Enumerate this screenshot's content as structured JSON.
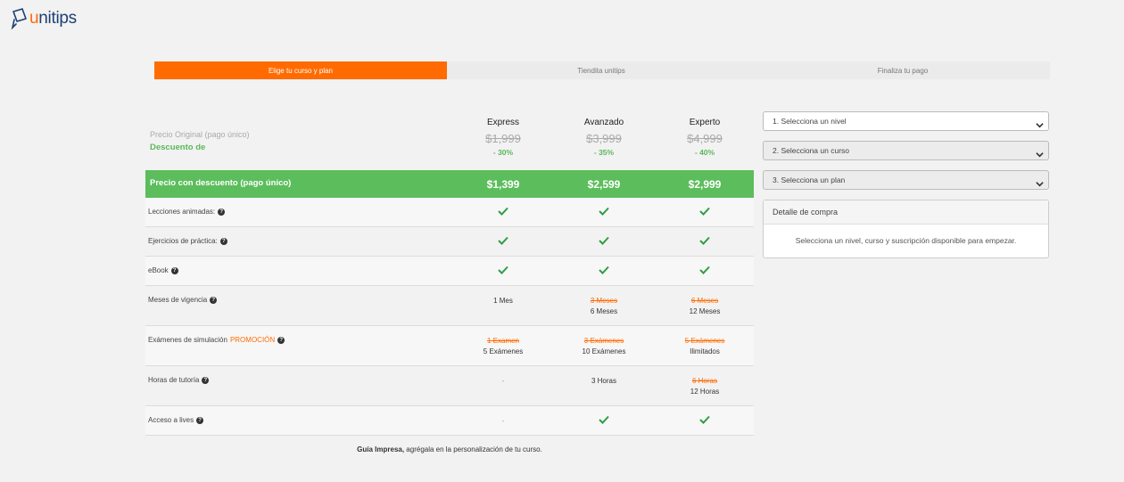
{
  "brand": {
    "logo_text_accent": "u",
    "logo_text_rest": "nitips"
  },
  "steps": [
    {
      "label": "Elige tu curso y plan",
      "active": true
    },
    {
      "label": "Tiendita unitips",
      "active": false
    },
    {
      "label": "Finaliza tu pago",
      "active": false
    }
  ],
  "plans_header": {
    "original_label": "Precio Original (pago único)",
    "discount_label": "Descuento de"
  },
  "plans": [
    {
      "name": "Express",
      "original": "$1,999",
      "discount": "- 30%",
      "price": "$1,399"
    },
    {
      "name": "Avanzado",
      "original": "$3,999",
      "discount": "- 35%",
      "price": "$2,599"
    },
    {
      "name": "Experto",
      "original": "$4,999",
      "discount": "- 40%",
      "price": "$2,999"
    }
  ],
  "price_row_label": "Precio con descuento (pago único)",
  "features": [
    {
      "label": "Lecciones animadas:"
    },
    {
      "label": "Ejercicios de práctica:"
    },
    {
      "label": "eBook"
    },
    {
      "label": "Meses de vigencia",
      "cells": [
        {
          "strike": "",
          "value": "1 Mes"
        },
        {
          "strike": "3 Meses",
          "value": "6 Meses"
        },
        {
          "strike": "6 Meses",
          "value": "12 Meses"
        }
      ]
    },
    {
      "label": "Exámenes de simulación",
      "promo": "PROMOCIÓN",
      "cells": [
        {
          "strike": "1 Examen",
          "value": "5 Exámenes"
        },
        {
          "strike": "3 Exámenes",
          "value": "10 Exámenes"
        },
        {
          "strike": "5 Exámenes",
          "value": "Ilimitados"
        }
      ]
    },
    {
      "label": "Horas de tutoría",
      "cells": [
        {
          "strike": "",
          "value": "-"
        },
        {
          "strike": "",
          "value": "3 Horas"
        },
        {
          "strike": "6 Horas",
          "value": "12 Horas"
        }
      ]
    },
    {
      "label": "Acceso a lives",
      "cells": [
        {
          "value": "-"
        }
      ]
    }
  ],
  "footer": {
    "bold": "Guía Impresa,",
    "rest": " agrégala en la personalización de tu curso."
  },
  "sidebar": {
    "select_level": "1. Selecciona un nivel",
    "select_course": "2. Selecciona un curso",
    "select_plan": "3. Selecciona un plan",
    "detail_title": "Detalle de compra",
    "detail_empty": "Selecciona un nivel, curso y suscripción disponible para empezar."
  },
  "colors": {
    "accent": "#ff6b00",
    "green": "#5cbd5c",
    "check": "#2e9e44",
    "brand_blue": "#1d3f73"
  },
  "icons": {
    "check": "check-icon",
    "help": "question-circle-icon",
    "chevron": "chevron-down-icon"
  }
}
